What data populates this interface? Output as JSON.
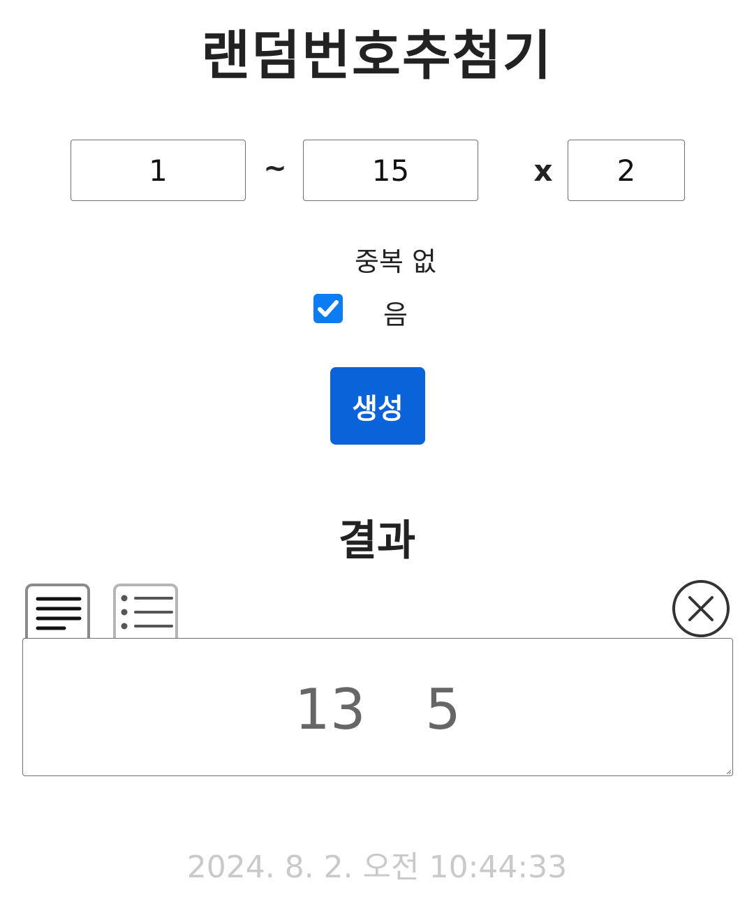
{
  "title": "랜덤번호추첨기",
  "range": {
    "from_value": "1",
    "separator": "~",
    "to_value": "15",
    "times_symbol": "x",
    "count_value": "2"
  },
  "options": {
    "no_duplicate_label_line1": "중복 없",
    "no_duplicate_label_line2": "음",
    "no_duplicate_checked": true,
    "checkbox_color": "#0d7bf2"
  },
  "generate_button": {
    "label": "생성",
    "color": "#0b63d9"
  },
  "result": {
    "heading": "결과",
    "view_tabs": [
      "text-view-icon",
      "list-view-icon"
    ],
    "clear_icon": "close-circle-icon",
    "values": "13 5"
  },
  "timestamp": "2024. 8. 2. 오전 10:44:33"
}
